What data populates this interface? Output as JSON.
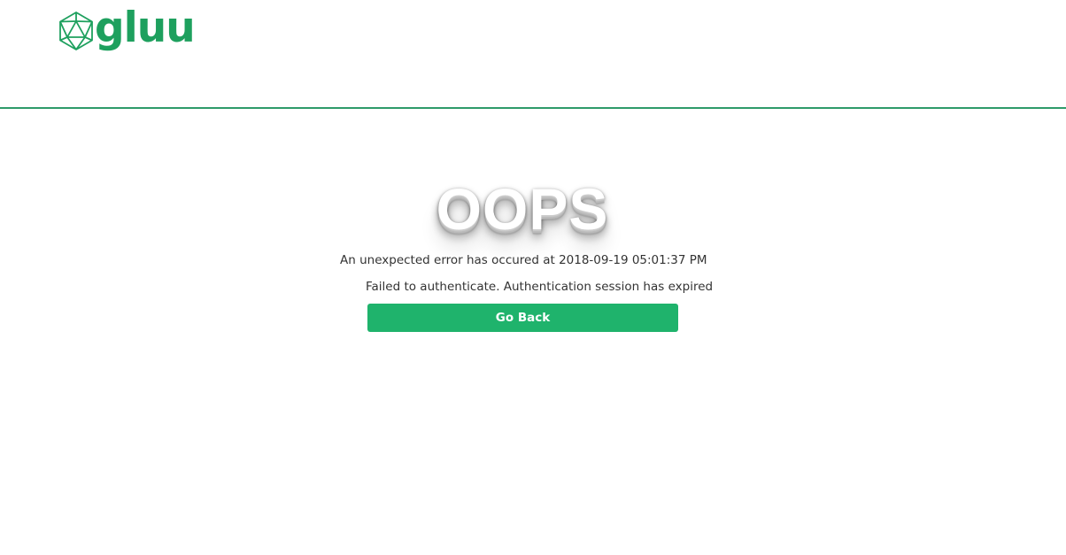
{
  "header": {
    "logo_text": "gluu",
    "logo_icon": "icosahedron-icon",
    "brand_color": "#1ea05e",
    "divider_color": "#2e9a6a"
  },
  "main": {
    "heading": "OOPS",
    "error_message": "An unexpected error has occured at 2018-09-19 05:01:37 PM",
    "detail_message": "Failed to authenticate. Authentication session has expired",
    "go_back_label": "Go Back",
    "button_color": "#1fb36c"
  }
}
